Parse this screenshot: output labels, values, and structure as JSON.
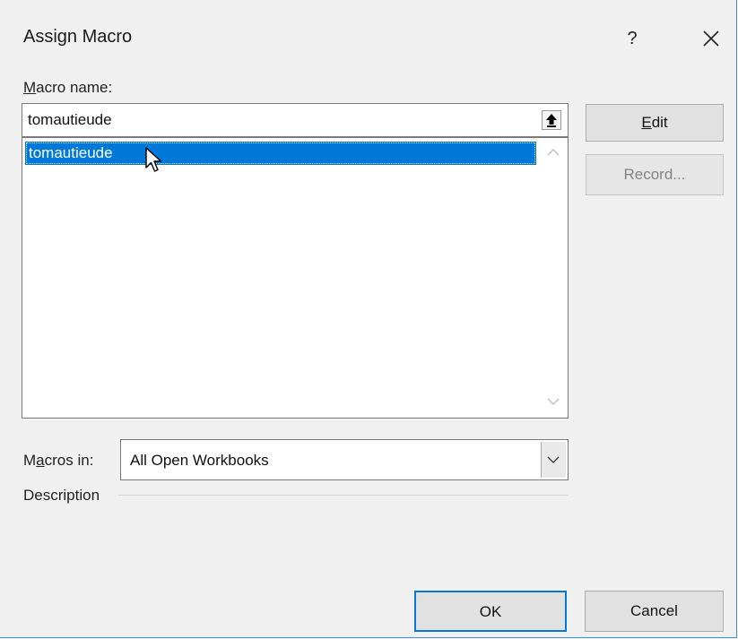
{
  "dialog": {
    "title": "Assign Macro",
    "help_label": "?"
  },
  "macro_name": {
    "label_accel": "M",
    "label_rest": "acro name:",
    "value": "tomautieude"
  },
  "macro_list": {
    "items": [
      "tomautieude"
    ],
    "selected_index": 0
  },
  "buttons": {
    "edit_accel": "E",
    "edit_rest": "dit",
    "record": "Record...",
    "ok": "OK",
    "cancel": "Cancel"
  },
  "macros_in": {
    "label_pre": "M",
    "label_accel": "a",
    "label_rest": "cros in:",
    "selected": "All Open Workbooks"
  },
  "description": {
    "label": "Description"
  },
  "colors": {
    "selection": "#0078d7",
    "window_border": "#4a8fd6",
    "dialog_bg": "#f0f0f0"
  },
  "icons": {
    "close": "close-icon",
    "collapse": "collapse-dialog-icon",
    "scroll_up": "chevron-up-icon",
    "scroll_down": "chevron-down-icon",
    "dropdown": "chevron-down-icon",
    "cursor": "mouse-pointer-icon"
  }
}
